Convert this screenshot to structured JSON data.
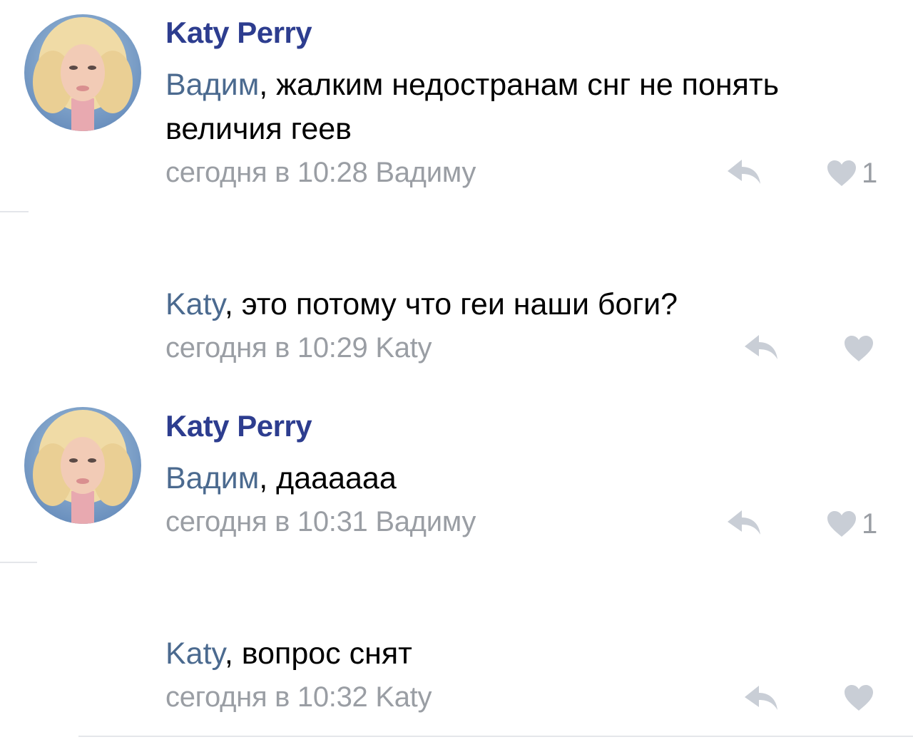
{
  "comments": [
    {
      "author": "Katy Perry",
      "mention": "Вадим",
      "text": ", жалким недостранам снг не понять величия геев",
      "time": "сегодня в 10:28",
      "reply_to": "Вадиму",
      "likes": "1"
    },
    {
      "author": "",
      "mention": "Katy",
      "text": ", это потому что геи наши боги?",
      "time": "сегодня в 10:29",
      "reply_to": "Katy",
      "likes": ""
    },
    {
      "author": "Katy Perry",
      "mention": "Вадим",
      "text": ", дааааaa",
      "time": "сегодня в 10:31",
      "reply_to": "Вадиму",
      "likes": "1"
    },
    {
      "author": "",
      "mention": "Katy",
      "text": ", вопрос снят",
      "time": "сегодня в 10:32",
      "reply_to": "Katy",
      "likes": ""
    }
  ],
  "icons": {
    "reply": "reply-arrow-icon",
    "like": "heart-icon"
  },
  "colors": {
    "author": "#2d3d8f",
    "mention": "#4b6a8f",
    "meta": "#9a9ea4",
    "icon": "#c9ced6"
  }
}
